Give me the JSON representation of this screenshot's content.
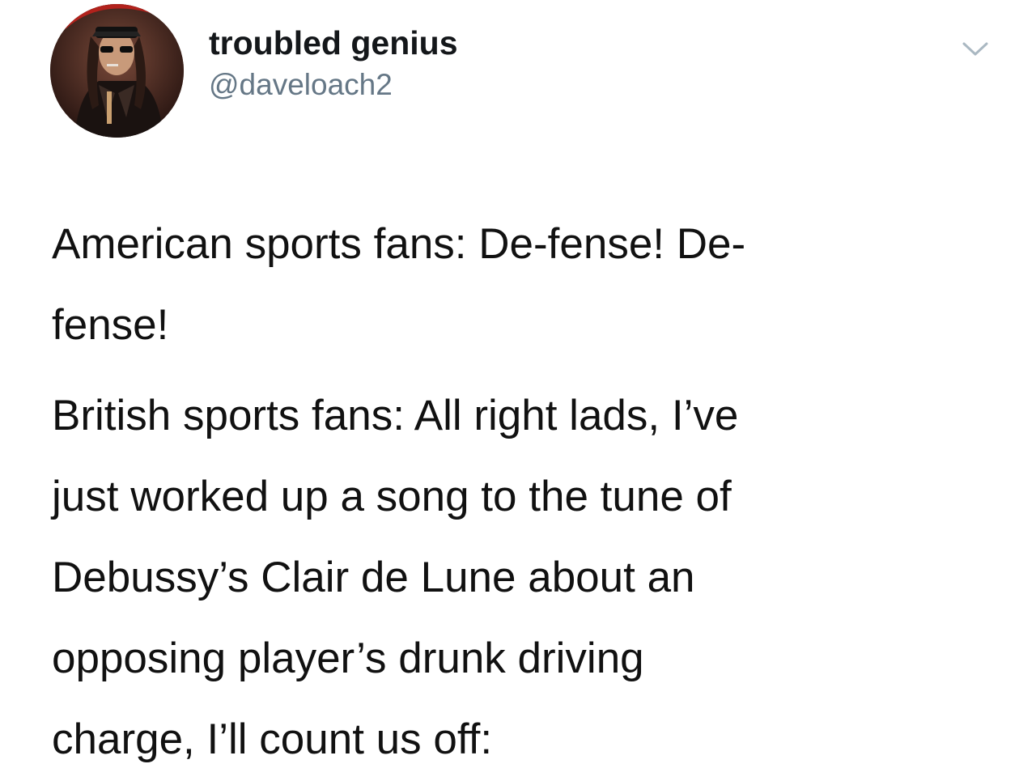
{
  "tweet": {
    "display_name": "troubled genius",
    "handle": "@daveloach2",
    "avatar_icon": "profile-photo",
    "menu_icon": "chevron-down-icon",
    "paragraphs": [
      {
        "lines": [
          "American sports fans: De-fense! De-",
          "fense!"
        ]
      },
      {
        "lines": [
          "British sports fans: All right lads, I’ve",
          "just worked up a song to the tune of",
          "Debussy’s Clair de Lune about an",
          "opposing player’s drunk driving",
          "charge, I’ll count us off:"
        ]
      }
    ]
  },
  "colors": {
    "text": "#111111",
    "handle": "#657786",
    "chevron": "#aab8c2"
  }
}
